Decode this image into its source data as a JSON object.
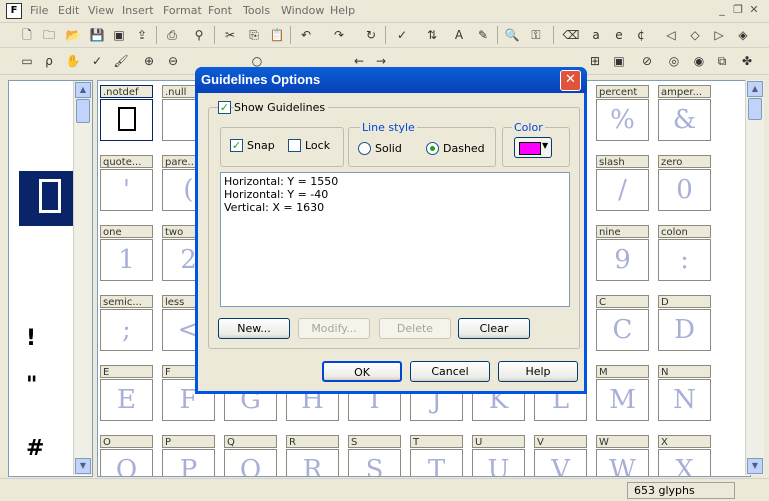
{
  "menu": [
    "File",
    "Edit",
    "View",
    "Insert",
    "Format",
    "Font",
    "Tools",
    "Window",
    "Help"
  ],
  "dialog": {
    "title": "Guidelines Options",
    "close": "✕",
    "show_guidelines": "Show Guidelines",
    "snap": "Snap",
    "lock": "Lock",
    "line_style_title": "Line style",
    "solid": "Solid",
    "dashed": "Dashed",
    "color_title": "Color",
    "color_value": "#ff00ff",
    "guidelines": [
      "Horizontal: Y = 1550",
      "Horizontal: Y = -40",
      "Vertical: X = 1630"
    ],
    "buttons": {
      "new": "New...",
      "modify": "Modify...",
      "delete": "Delete",
      "clear": "Clear",
      "ok": "OK",
      "cancel": "Cancel",
      "help": "Help"
    }
  },
  "status": {
    "glyph_count": "653 glyphs"
  },
  "left_glyphs": [
    "!",
    "\"",
    "#"
  ],
  "grid": {
    "rows": [
      [
        {
          "name": ".notdef",
          "glyph": ""
        },
        {
          "name": ".null",
          "glyph": ""
        },
        null,
        null,
        null,
        null,
        null,
        null,
        {
          "name": "percent",
          "glyph": "%"
        },
        {
          "name": "amper...",
          "glyph": "&"
        }
      ],
      [
        {
          "name": "quote...",
          "glyph": "'"
        },
        {
          "name": "pare...",
          "glyph": "("
        },
        null,
        null,
        null,
        null,
        null,
        null,
        {
          "name": "slash",
          "glyph": "/"
        },
        {
          "name": "zero",
          "glyph": "0"
        }
      ],
      [
        {
          "name": "one",
          "glyph": "1"
        },
        {
          "name": "two",
          "glyph": "2"
        },
        null,
        null,
        null,
        null,
        null,
        null,
        {
          "name": "nine",
          "glyph": "9"
        },
        {
          "name": "colon",
          "glyph": ":"
        }
      ],
      [
        {
          "name": "semic...",
          "glyph": ";"
        },
        {
          "name": "less",
          "glyph": "<"
        },
        null,
        null,
        null,
        null,
        null,
        null,
        {
          "name": "C",
          "glyph": "C"
        },
        {
          "name": "D",
          "glyph": "D"
        }
      ],
      [
        {
          "name": "E",
          "glyph": "E"
        },
        {
          "name": "F",
          "glyph": "F"
        },
        {
          "name": "",
          "glyph": "G"
        },
        {
          "name": "",
          "glyph": "H"
        },
        {
          "name": "",
          "glyph": "I"
        },
        {
          "name": "",
          "glyph": "J"
        },
        {
          "name": "",
          "glyph": "K"
        },
        {
          "name": "",
          "glyph": "L"
        },
        {
          "name": "M",
          "glyph": "M"
        },
        {
          "name": "N",
          "glyph": "N"
        }
      ],
      [
        {
          "name": "O",
          "glyph": "O"
        },
        {
          "name": "P",
          "glyph": "P"
        },
        {
          "name": "Q",
          "glyph": "Q"
        },
        {
          "name": "R",
          "glyph": "R"
        },
        {
          "name": "S",
          "glyph": "S"
        },
        {
          "name": "T",
          "glyph": "T"
        },
        {
          "name": "U",
          "glyph": "U"
        },
        {
          "name": "V",
          "glyph": "V"
        },
        {
          "name": "W",
          "glyph": "W"
        },
        {
          "name": "X",
          "glyph": "X"
        }
      ]
    ]
  }
}
